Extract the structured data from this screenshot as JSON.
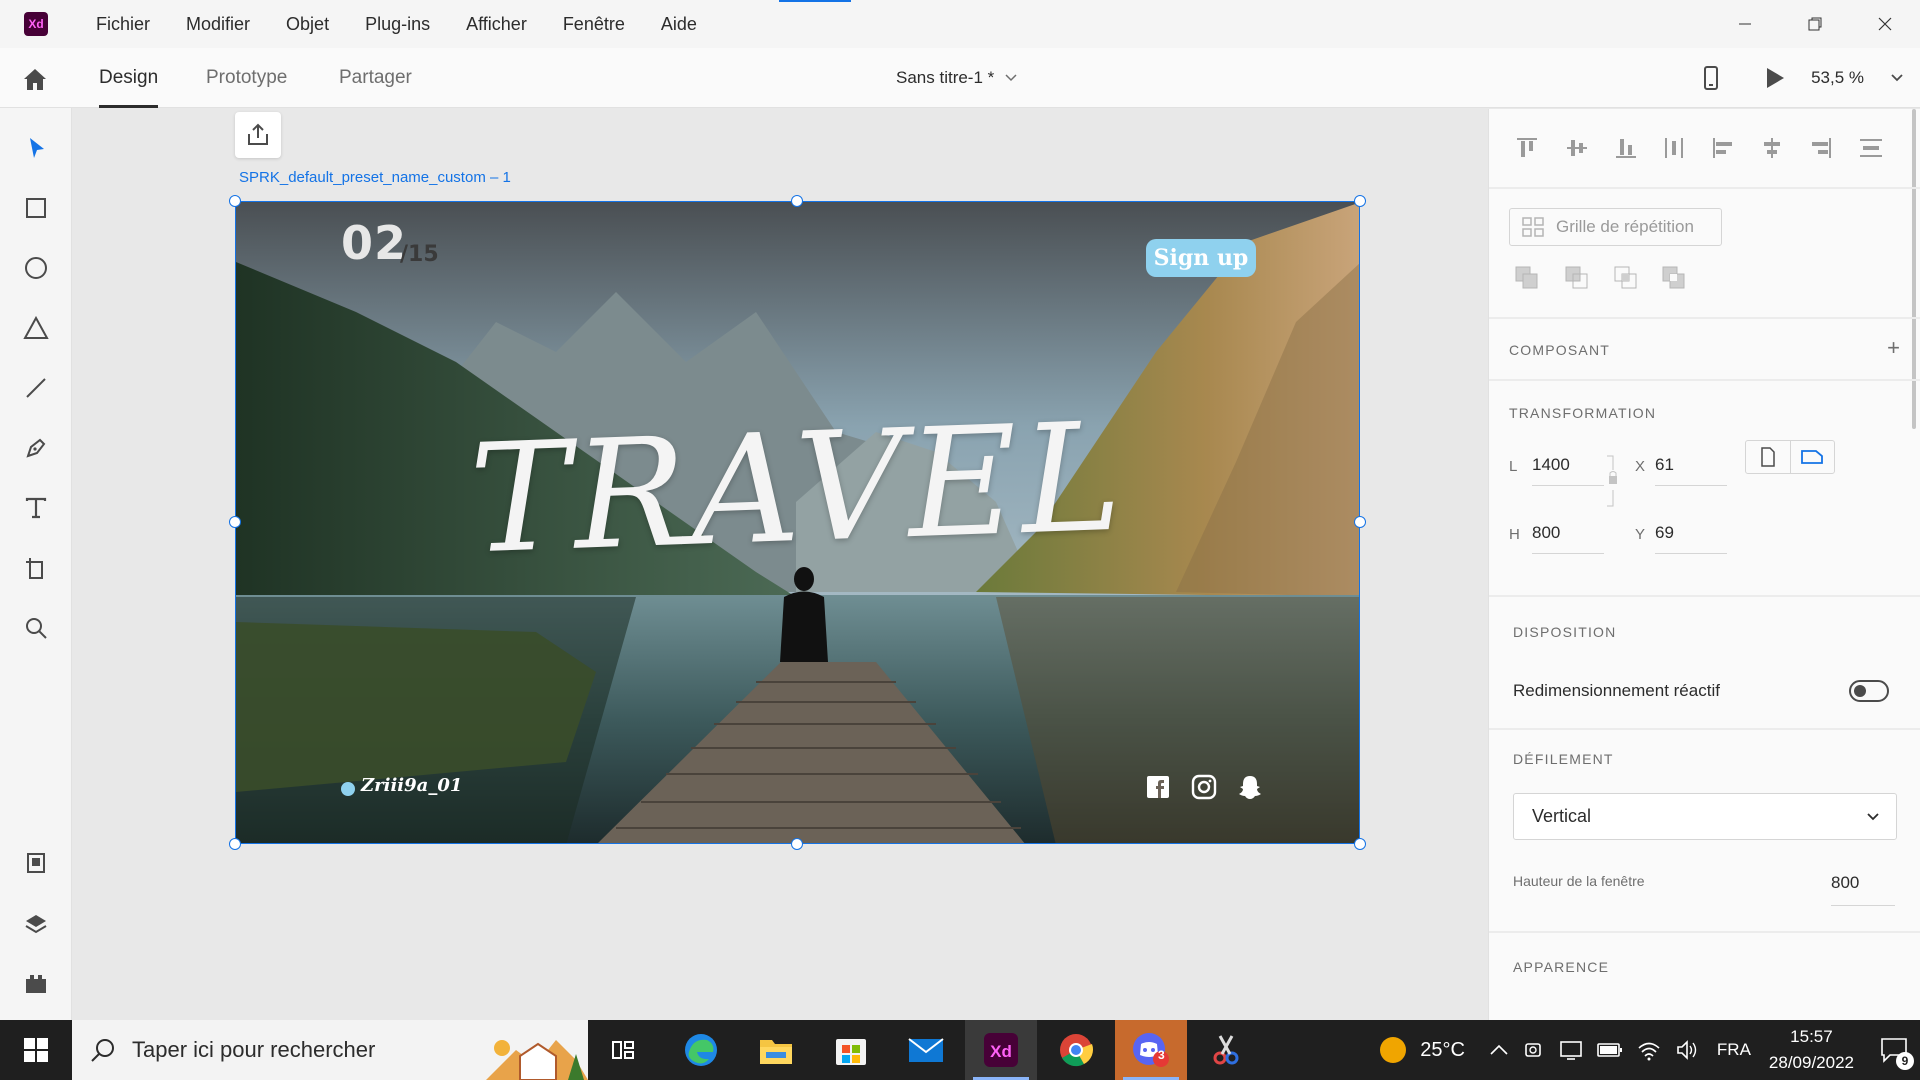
{
  "app": {
    "logo_text": "Xd",
    "menu": [
      "Fichier",
      "Modifier",
      "Objet",
      "Plug-ins",
      "Afficher",
      "Fenêtre",
      "Aide"
    ]
  },
  "tabs": {
    "design": "Design",
    "prototype": "Prototype",
    "share": "Partager",
    "active": "Design"
  },
  "document": {
    "title": "Sans titre-1 *",
    "zoom": "53,5 %"
  },
  "artboard": {
    "name": "SPRK_default_preset_name_custom – 1",
    "page_current": "02",
    "page_total": "/15",
    "signup_label": "Sign up",
    "headline": "TRAVEL",
    "handle": "Zriii9a_01",
    "accent_color": "#8fd1ee"
  },
  "panel": {
    "repeat_grid": "Grille de répétition",
    "component_title": "COMPOSANT",
    "transform_title": "TRANSFORMATION",
    "fields": {
      "w_label": "L",
      "w_value": "1400",
      "x_label": "X",
      "x_value": "61",
      "h_label": "H",
      "h_value": "800",
      "y_label": "Y",
      "y_value": "69"
    },
    "layout_title": "DISPOSITION",
    "responsive_label": "Redimensionnement réactif",
    "responsive_on": false,
    "scroll_title": "DÉFILEMENT",
    "scroll_value": "Vertical",
    "viewport_label": "Hauteur de la fenêtre",
    "viewport_value": "800",
    "appearance_title": "APPARENCE"
  },
  "taskbar": {
    "search_placeholder": "Taper ici pour rechercher",
    "temperature": "25°C",
    "language": "FRA",
    "time": "15:57",
    "date": "28/09/2022",
    "notifications": "9",
    "discord_badge": "3"
  }
}
